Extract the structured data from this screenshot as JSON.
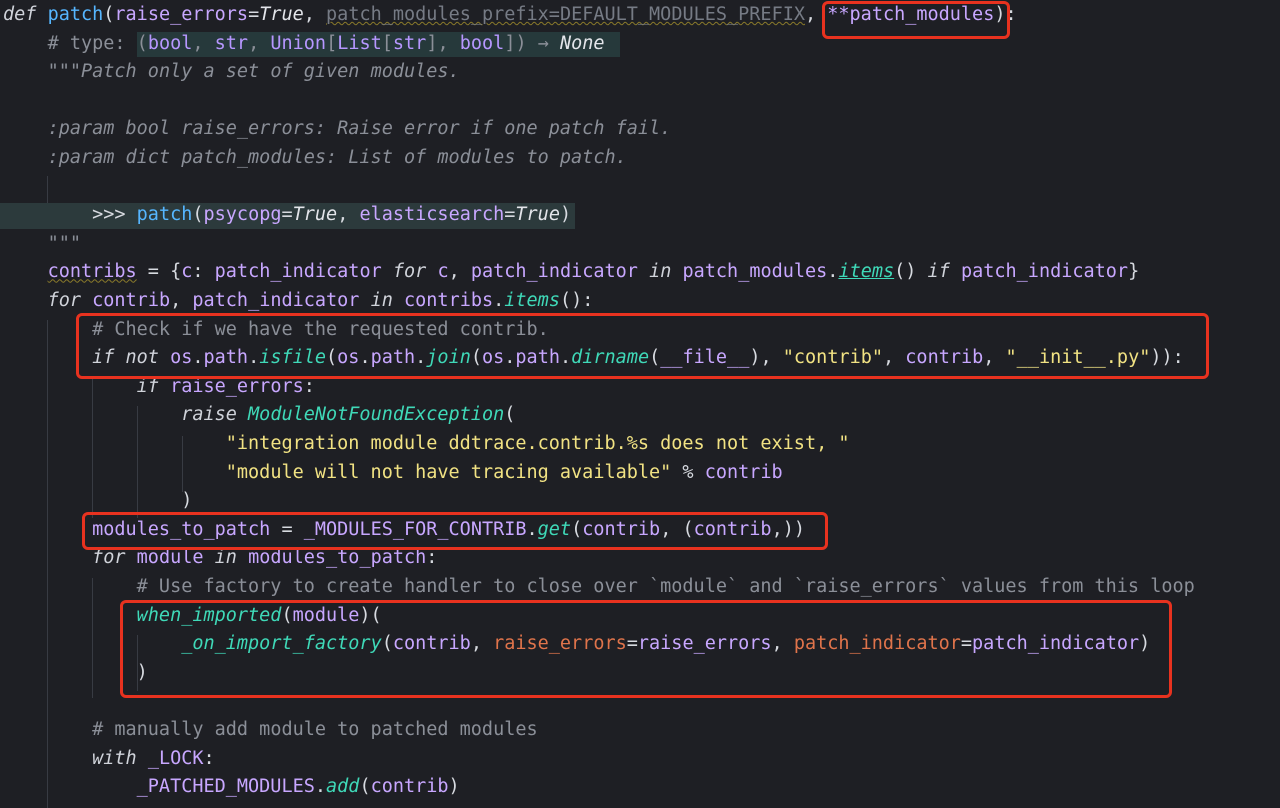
{
  "editor": {
    "language": "python",
    "theme": {
      "background": "#1e1f24",
      "highlight_box": "#e8321f"
    },
    "lines": [
      {
        "tokens": [
          [
            "kw",
            "def "
          ],
          [
            "fn",
            "patch"
          ],
          [
            "pun",
            "("
          ],
          [
            "var",
            "raise_errors"
          ],
          [
            "pun",
            "="
          ],
          [
            "const",
            "True"
          ],
          [
            "pun",
            ", "
          ],
          [
            "dim",
            "patch_modules_prefix=DEFAULT_MODULES_PREFIX"
          ],
          [
            "pun",
            ", "
          ],
          [
            "var",
            "**patch_modules"
          ],
          [
            "pun",
            "):"
          ]
        ]
      },
      {
        "tokens": [
          [
            "pun",
            "    "
          ],
          [
            "cmt",
            "# type: "
          ],
          [
            "cmt",
            "("
          ],
          [
            "typ",
            "bool"
          ],
          [
            "cmt",
            ", "
          ],
          [
            "typ",
            "str"
          ],
          [
            "cmt",
            ", "
          ],
          [
            "typ",
            "Union"
          ],
          [
            "cmt",
            "["
          ],
          [
            "typ",
            "List"
          ],
          [
            "cmt",
            "["
          ],
          [
            "typ",
            "str"
          ],
          [
            "cmt",
            "], "
          ],
          [
            "typ",
            "bool"
          ],
          [
            "cmt",
            "]) → "
          ],
          [
            "const",
            "None"
          ]
        ]
      },
      {
        "tokens": [
          [
            "pun",
            "    "
          ],
          [
            "doc",
            "\"\"\"Patch only a set of given modules."
          ]
        ]
      },
      {
        "tokens": [
          [
            "pun",
            ""
          ]
        ]
      },
      {
        "tokens": [
          [
            "pun",
            "    "
          ],
          [
            "doc",
            ":param bool raise_errors: Raise error if one patch fail."
          ]
        ]
      },
      {
        "tokens": [
          [
            "pun",
            "    "
          ],
          [
            "doc",
            ":param dict patch_modules: List of modules to patch."
          ]
        ]
      },
      {
        "tokens": [
          [
            "pun",
            ""
          ]
        ]
      },
      {
        "tokens": [
          [
            "pun",
            "        "
          ],
          [
            "pun",
            ">>> "
          ],
          [
            "fn",
            "patch"
          ],
          [
            "pun",
            "("
          ],
          [
            "var",
            "psycopg"
          ],
          [
            "pun",
            "="
          ],
          [
            "const",
            "True"
          ],
          [
            "pun",
            ", "
          ],
          [
            "var",
            "elasticsearch"
          ],
          [
            "pun",
            "="
          ],
          [
            "const",
            "True"
          ],
          [
            "pun",
            ")"
          ]
        ]
      },
      {
        "tokens": [
          [
            "pun",
            "    "
          ],
          [
            "doc",
            "\"\"\""
          ]
        ]
      },
      {
        "tokens": [
          [
            "pun",
            "    "
          ],
          [
            "var",
            "contribs"
          ],
          [
            "pun",
            " = {"
          ],
          [
            "var",
            "c"
          ],
          [
            "pun",
            ": "
          ],
          [
            "var",
            "patch_indicator"
          ],
          [
            "kw",
            " for "
          ],
          [
            "var",
            "c"
          ],
          [
            "pun",
            ", "
          ],
          [
            "var",
            "patch_indicator"
          ],
          [
            "kw",
            " in "
          ],
          [
            "var",
            "patch_modules"
          ],
          [
            "pun",
            "."
          ],
          [
            "fnu",
            "items"
          ],
          [
            "pun",
            "()"
          ],
          [
            "kw",
            " if "
          ],
          [
            "var",
            "patch_indicator"
          ],
          [
            "pun",
            "}"
          ]
        ]
      },
      {
        "tokens": [
          [
            "pun",
            "    "
          ],
          [
            "kw",
            "for "
          ],
          [
            "var",
            "contrib"
          ],
          [
            "pun",
            ", "
          ],
          [
            "var",
            "patch_indicator"
          ],
          [
            "kw",
            " in "
          ],
          [
            "var",
            "contribs"
          ],
          [
            "pun",
            "."
          ],
          [
            "fnc",
            "items"
          ],
          [
            "pun",
            "():"
          ]
        ]
      },
      {
        "tokens": [
          [
            "pun",
            "        "
          ],
          [
            "cmt",
            "# Check if we have the requested contrib."
          ]
        ]
      },
      {
        "tokens": [
          [
            "pun",
            "        "
          ],
          [
            "kw",
            "if not "
          ],
          [
            "var",
            "os"
          ],
          [
            "pun",
            "."
          ],
          [
            "var",
            "path"
          ],
          [
            "pun",
            "."
          ],
          [
            "fnc",
            "isfile"
          ],
          [
            "pun",
            "("
          ],
          [
            "var",
            "os"
          ],
          [
            "pun",
            "."
          ],
          [
            "var",
            "path"
          ],
          [
            "pun",
            "."
          ],
          [
            "fnc",
            "join"
          ],
          [
            "pun",
            "("
          ],
          [
            "var",
            "os"
          ],
          [
            "pun",
            "."
          ],
          [
            "var",
            "path"
          ],
          [
            "pun",
            "."
          ],
          [
            "fnc",
            "dirname"
          ],
          [
            "pun",
            "("
          ],
          [
            "var",
            "__file__"
          ],
          [
            "pun",
            "), "
          ],
          [
            "str",
            "\"contrib\""
          ],
          [
            "pun",
            ", "
          ],
          [
            "var",
            "contrib"
          ],
          [
            "pun",
            ", "
          ],
          [
            "str",
            "\"__init__.py\""
          ],
          [
            "pun",
            "))"
          ],
          [
            "pun",
            ":"
          ]
        ]
      },
      {
        "tokens": [
          [
            "pun",
            "            "
          ],
          [
            "kw",
            "if "
          ],
          [
            "var",
            "raise_errors"
          ],
          [
            "pun",
            ":"
          ]
        ]
      },
      {
        "tokens": [
          [
            "pun",
            "                "
          ],
          [
            "kw",
            "raise "
          ],
          [
            "cls",
            "ModuleNotFoundException"
          ],
          [
            "pun",
            "("
          ]
        ]
      },
      {
        "tokens": [
          [
            "pun",
            "                    "
          ],
          [
            "str",
            "\"integration module ddtrace.contrib.%s does not exist, \""
          ]
        ]
      },
      {
        "tokens": [
          [
            "pun",
            "                    "
          ],
          [
            "str",
            "\"module will not have tracing available\""
          ],
          [
            "pun",
            " % "
          ],
          [
            "var",
            "contrib"
          ]
        ]
      },
      {
        "tokens": [
          [
            "pun",
            "                "
          ],
          [
            "pun",
            ")"
          ]
        ]
      },
      {
        "tokens": [
          [
            "pun",
            "        "
          ],
          [
            "var",
            "modules_to_patch"
          ],
          [
            "pun",
            " = "
          ],
          [
            "var",
            "_MODULES_FOR_CONTRIB"
          ],
          [
            "pun",
            "."
          ],
          [
            "fnc",
            "get"
          ],
          [
            "pun",
            "("
          ],
          [
            "var",
            "contrib"
          ],
          [
            "pun",
            ", ("
          ],
          [
            "var",
            "contrib"
          ],
          [
            "pun",
            ",))"
          ]
        ]
      },
      {
        "tokens": [
          [
            "pun",
            "        "
          ],
          [
            "kw",
            "for "
          ],
          [
            "var",
            "module"
          ],
          [
            "kw",
            " in "
          ],
          [
            "var",
            "modules_to_patch"
          ],
          [
            "pun",
            ":"
          ]
        ]
      },
      {
        "tokens": [
          [
            "pun",
            "            "
          ],
          [
            "cmt",
            "# Use factory to create handler to close over `module` and `raise_errors` values from this loop"
          ]
        ]
      },
      {
        "tokens": [
          [
            "pun",
            "            "
          ],
          [
            "fnc",
            "when_imported"
          ],
          [
            "pun",
            "("
          ],
          [
            "var",
            "module"
          ],
          [
            "pun",
            ")("
          ]
        ]
      },
      {
        "tokens": [
          [
            "pun",
            "                "
          ],
          [
            "fnc",
            "_on_import_factory"
          ],
          [
            "pun",
            "("
          ],
          [
            "var",
            "contrib"
          ],
          [
            "pun",
            ", "
          ],
          [
            "param",
            "raise_errors"
          ],
          [
            "pun",
            "="
          ],
          [
            "var",
            "raise_errors"
          ],
          [
            "pun",
            ", "
          ],
          [
            "param",
            "patch_indicator"
          ],
          [
            "pun",
            "="
          ],
          [
            "var",
            "patch_indicator"
          ],
          [
            "pun",
            ")"
          ]
        ]
      },
      {
        "tokens": [
          [
            "pun",
            "            "
          ],
          [
            "pun",
            ")"
          ]
        ]
      },
      {
        "tokens": [
          [
            "pun",
            ""
          ]
        ]
      },
      {
        "tokens": [
          [
            "pun",
            "        "
          ],
          [
            "cmt",
            "# manually add module to patched modules"
          ]
        ]
      },
      {
        "tokens": [
          [
            "pun",
            "        "
          ],
          [
            "kw",
            "with "
          ],
          [
            "var",
            "_LOCK"
          ],
          [
            "pun",
            ":"
          ]
        ]
      },
      {
        "tokens": [
          [
            "pun",
            "            "
          ],
          [
            "var",
            "_PATCHED_MODULES"
          ],
          [
            "pun",
            "."
          ],
          [
            "fnc",
            "add"
          ],
          [
            "pun",
            "("
          ],
          [
            "var",
            "contrib"
          ],
          [
            "pun",
            ")"
          ]
        ]
      }
    ]
  }
}
